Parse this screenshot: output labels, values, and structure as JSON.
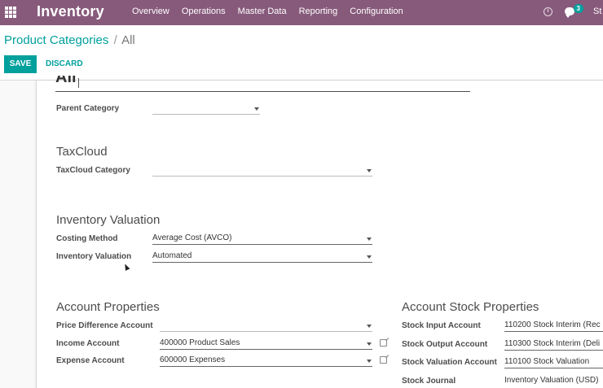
{
  "navbar": {
    "app_name": "Inventory",
    "menu": [
      "Overview",
      "Operations",
      "Master Data",
      "Reporting",
      "Configuration"
    ],
    "chat_count": "3",
    "user_text": "St",
    "color": "#875a7b"
  },
  "breadcrumb": {
    "parent": "Product Categories",
    "separator": "/",
    "current": "All"
  },
  "buttons": {
    "save": "SAVE",
    "discard": "DISCARD"
  },
  "form": {
    "name_value": "All",
    "parent_category": {
      "label": "Parent Category",
      "value": ""
    },
    "taxcloud": {
      "title": "TaxCloud",
      "category_label": "TaxCloud Category",
      "category_value": ""
    },
    "inventory_valuation": {
      "title": "Inventory Valuation",
      "costing_label": "Costing Method",
      "costing_value": "Average Cost (AVCO)",
      "valuation_label": "Inventory Valuation",
      "valuation_value": "Automated"
    },
    "account_properties": {
      "title": "Account Properties",
      "price_diff_label": "Price Difference Account",
      "price_diff_value": "",
      "income_label": "Income Account",
      "income_value": "400000 Product Sales",
      "expense_label": "Expense Account",
      "expense_value": "600000 Expenses"
    },
    "account_stock_properties": {
      "title": "Account Stock Properties",
      "input_label": "Stock Input Account",
      "input_value": "110200 Stock Interim (Rec",
      "output_label": "Stock Output Account",
      "output_value": "110300 Stock Interim (Deli",
      "valuation_label": "Stock Valuation Account",
      "valuation_value": "110100 Stock Valuation",
      "journal_label": "Stock Journal",
      "journal_value": "Inventory Valuation (USD)"
    }
  },
  "accent_color": "#00a09d"
}
